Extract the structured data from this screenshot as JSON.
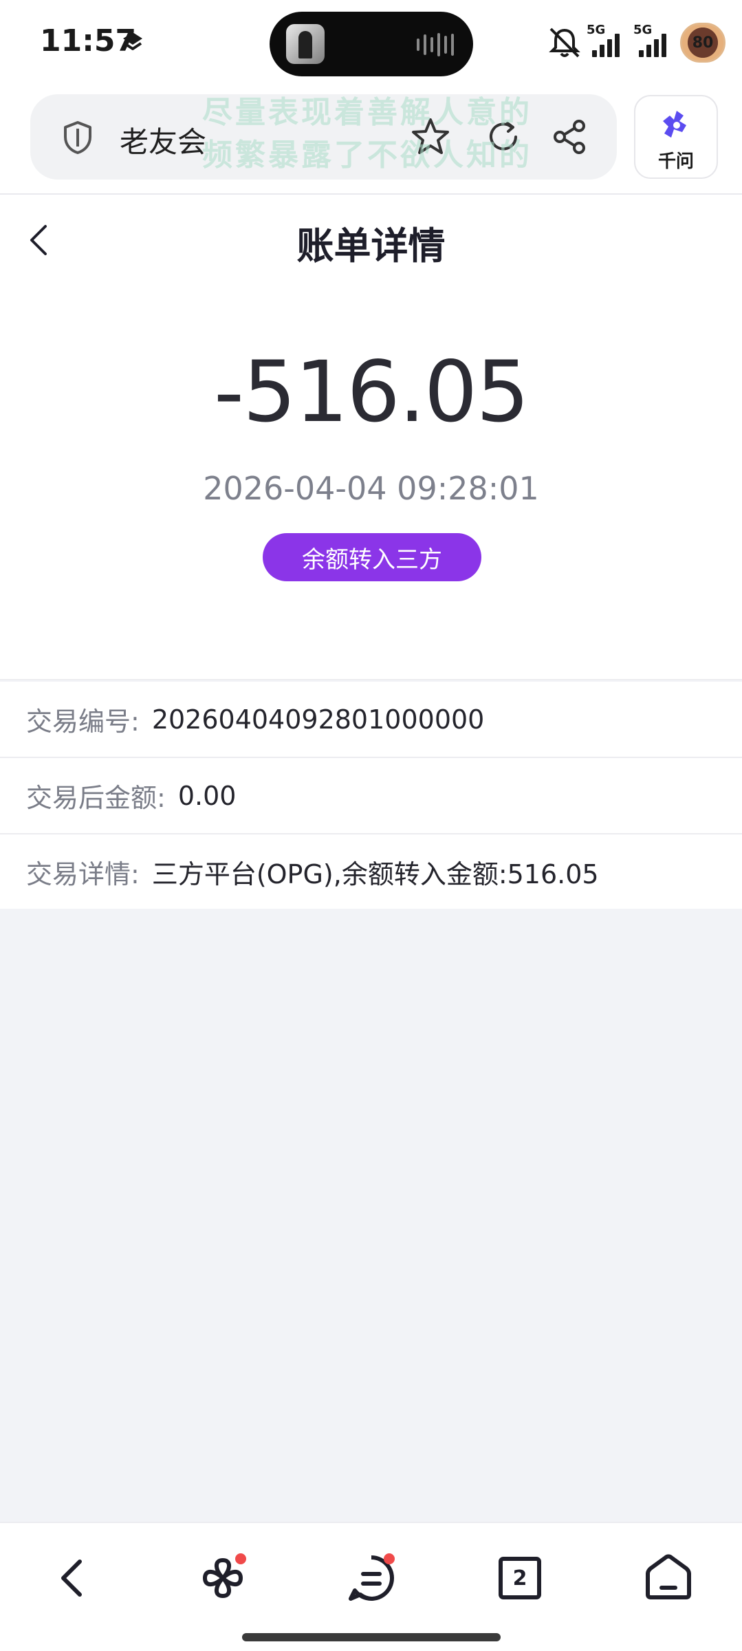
{
  "status_bar": {
    "time": "11:57",
    "network_1": "5G",
    "network_2": "5G",
    "battery": "80"
  },
  "browser": {
    "url_text": "老友会",
    "overlay_line_1": "尽量表现着善解人意的",
    "overlay_line_2": "频繁暴露了不欲人知的",
    "assistant_label": "千问"
  },
  "page": {
    "title": "账单详情"
  },
  "bill": {
    "amount": "-516.05",
    "datetime": "2026-04-04 09:28:01",
    "type_label": "余额转入三方"
  },
  "details": [
    {
      "key": "交易编号:",
      "value": "20260404092801000000"
    },
    {
      "key": "交易后金额:",
      "value": "0.00"
    },
    {
      "key": "交易详情:",
      "value": "三方平台(OPG),余额转入金额:516.05"
    }
  ],
  "bottom_nav": {
    "tab_count": "2",
    "icons": [
      "back-icon",
      "apps-icon",
      "messages-icon",
      "tabs-icon",
      "home-icon"
    ]
  },
  "colors": {
    "accent": "#8b35e8",
    "background": "#f2f3f7",
    "muted_text": "#7a7d88",
    "badge": "#f04a4a"
  }
}
